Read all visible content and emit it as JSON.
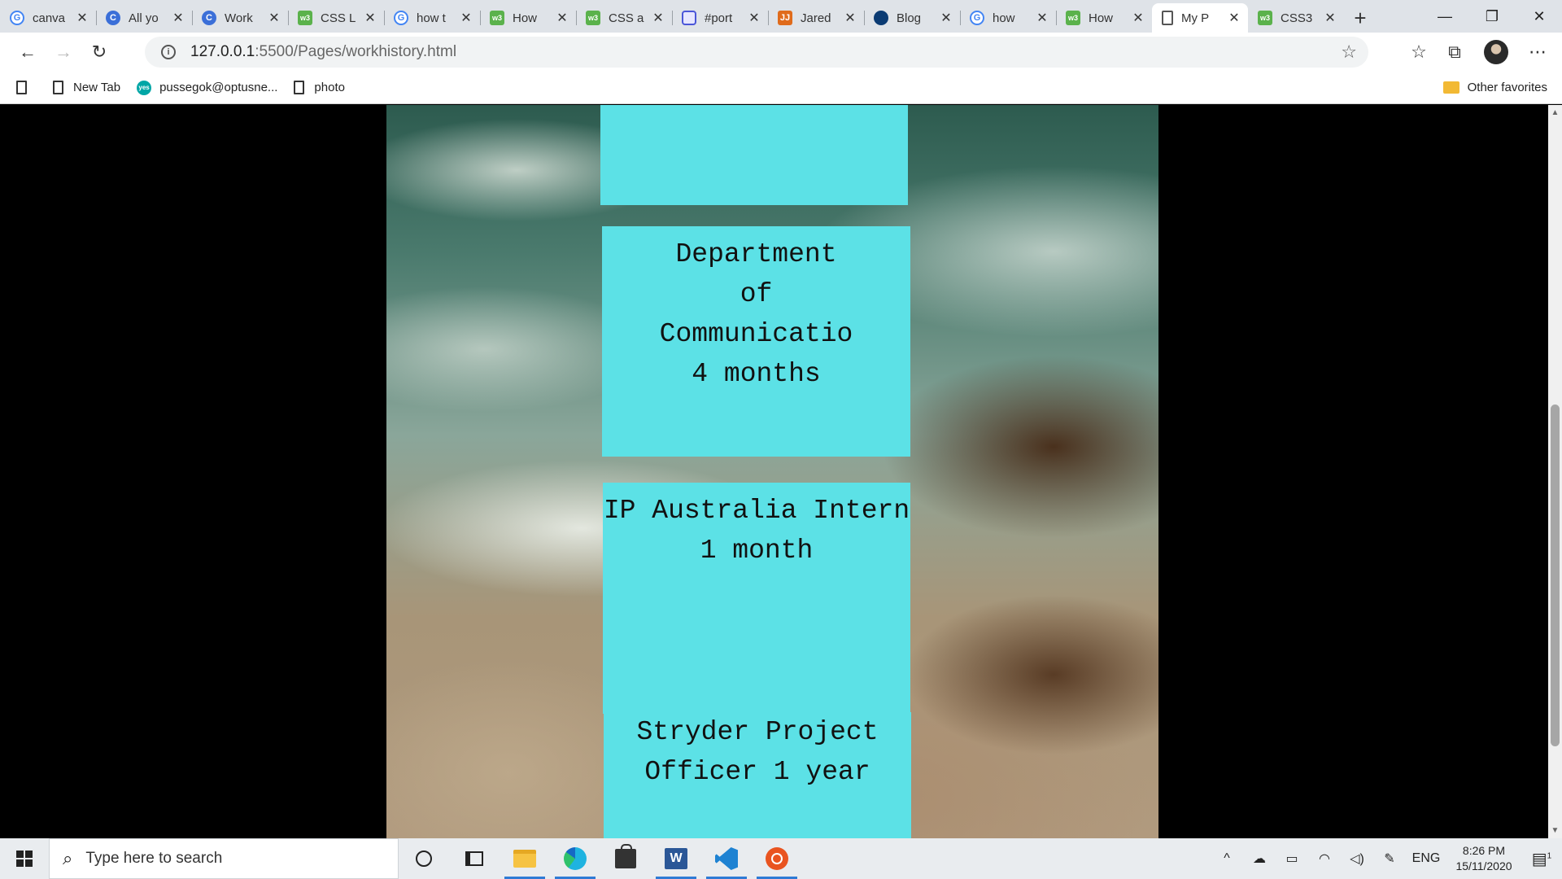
{
  "browser": {
    "tabs": [
      {
        "title": "canva",
        "favicon": "google-icon",
        "active": false
      },
      {
        "title": "All yo",
        "favicon": "c-icon",
        "active": false
      },
      {
        "title": "Work",
        "favicon": "c-icon",
        "active": false
      },
      {
        "title": "CSS L",
        "favicon": "w3schools-icon",
        "active": false
      },
      {
        "title": "how t",
        "favicon": "google-icon",
        "active": false
      },
      {
        "title": "How",
        "favicon": "w3schools-icon",
        "active": false
      },
      {
        "title": "CSS a",
        "favicon": "w3schools-icon",
        "active": false
      },
      {
        "title": "#port",
        "favicon": "pinterest-icon",
        "active": false
      },
      {
        "title": "Jared",
        "favicon": "jared-icon",
        "active": false
      },
      {
        "title": "Blog",
        "favicon": "blog-icon",
        "active": false
      },
      {
        "title": "how",
        "favicon": "google-icon",
        "active": false
      },
      {
        "title": "How",
        "favicon": "w3schools-icon",
        "active": false
      },
      {
        "title": "My P",
        "favicon": "document-icon",
        "active": true
      },
      {
        "title": "CSS3",
        "favicon": "w3schools-icon",
        "active": false
      }
    ],
    "address": {
      "host": "127.0.0.1",
      "path": ":5500/Pages/workhistory.html"
    },
    "bookmarks": [
      {
        "label": "New Tab"
      },
      {
        "label": "pussegok@optusne..."
      },
      {
        "label": "photo"
      }
    ],
    "other_favorites": "Other favorites"
  },
  "page": {
    "jobs": [
      {
        "lines": [
          "",
          "",
          ""
        ]
      },
      {
        "lines": [
          "Department",
          "of",
          "Communicatio",
          "4 months"
        ]
      },
      {
        "lines": [
          "IP Australia Intern",
          "1 month"
        ]
      },
      {
        "lines": [
          "Stryder Project",
          "Officer 1 year"
        ]
      }
    ],
    "colors": {
      "card": "#5ce1e6",
      "page_bg": "#000000"
    }
  },
  "taskbar": {
    "search_placeholder": "Type here to search",
    "language": "ENG",
    "time": "8:26 PM",
    "date": "15/11/2020",
    "notification_count": "1"
  }
}
